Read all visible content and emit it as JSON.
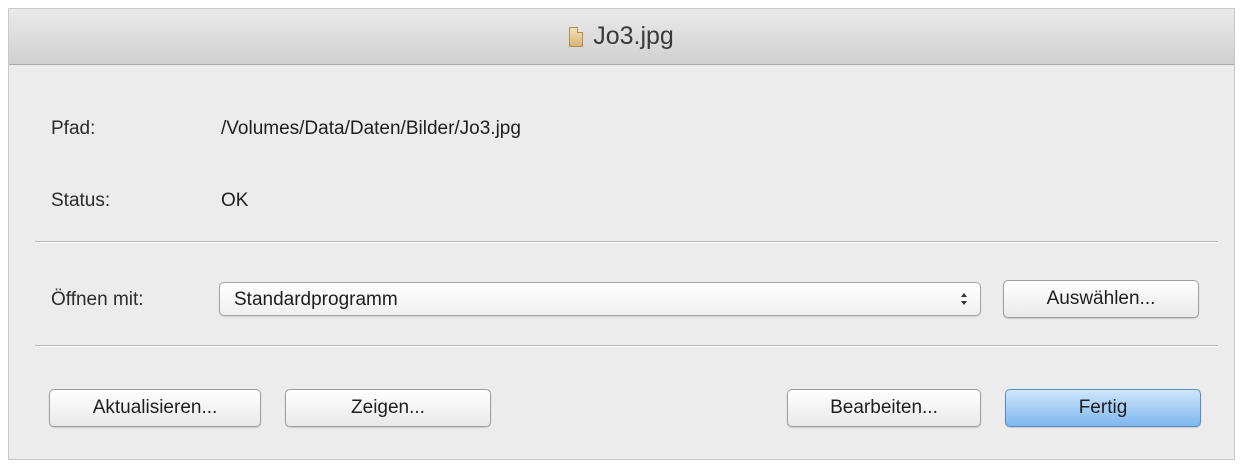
{
  "window": {
    "title": "Jo3.jpg",
    "title_icon": "document-icon"
  },
  "info": {
    "path_label": "Pfad:",
    "path_value": "/Volumes/Data/Daten/Bilder/Jo3.jpg",
    "status_label": "Status:",
    "status_value": "OK"
  },
  "open_with": {
    "label": "Öffnen mit:",
    "selected": "Standardprogramm",
    "choose_button": "Auswählen..."
  },
  "buttons": {
    "refresh": "Aktualisieren...",
    "show": "Zeigen...",
    "edit": "Bearbeiten...",
    "done": "Fertig"
  },
  "colors": {
    "window_bg": "#ececec",
    "primary_button": "#7eb7ef"
  }
}
